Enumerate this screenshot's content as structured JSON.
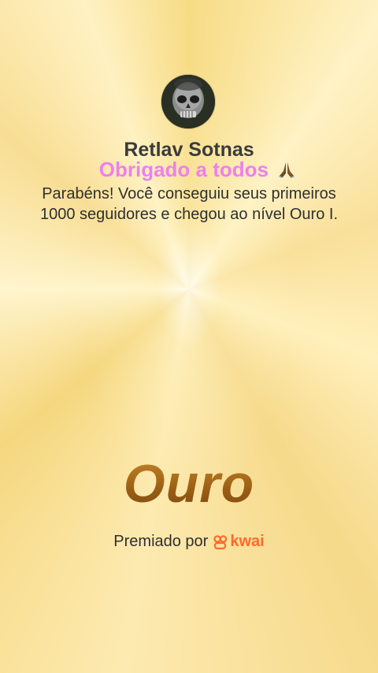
{
  "profile": {
    "avatar_icon": "skull-mask-avatar",
    "username": "Retlav Sotnas"
  },
  "caption": {
    "text": "Obrigado a todos",
    "emoji_icon": "folded-hands-emoji",
    "color": "#f07ef0"
  },
  "message": {
    "text": "Parabéns! Você conseguiu seus primeiros 1000 seguidores e chegou ao nível Ouro I."
  },
  "level": {
    "title": "Ouro",
    "color": "#a8691c"
  },
  "footer": {
    "awarded_by": "Premiado por",
    "brand_icon": "kwai-logo-icon",
    "brand_name": "kwai",
    "brand_color": "#ff6a2b"
  }
}
